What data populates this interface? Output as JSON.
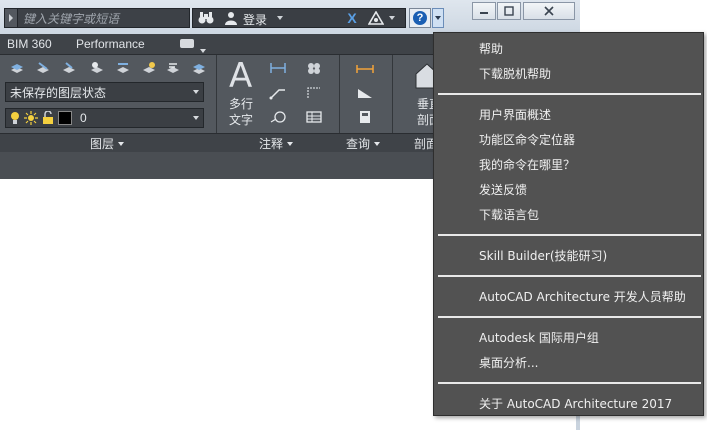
{
  "titlebar": {
    "search_placeholder": "键入关键字或短语",
    "login_label": "登录",
    "help_icon": "help-question-icon"
  },
  "tabs": [
    "BIM 360",
    "Performance"
  ],
  "ribbon": {
    "layer_state": "未保存的图层状态",
    "layer_name": "0",
    "mtext_line1": "多行",
    "mtext_line2": "文字",
    "panels": {
      "layers": "图层",
      "annotation": "注释",
      "query": "查询",
      "section": "剖面",
      "section_btn_1": "垂直",
      "section_btn_2": "剖面"
    }
  },
  "help_menu": {
    "items": [
      "帮助",
      "下载脱机帮助",
      "用户界面概述",
      "功能区命令定位器",
      "我的命令在哪里？",
      "发送反馈",
      "下载语言包",
      "Skill Builder(技能研习)",
      "AutoCAD Architecture 开发人员帮助",
      "Autodesk 国际用户组",
      "桌面分析...",
      "关于 AutoCAD Architecture 2017"
    ]
  }
}
